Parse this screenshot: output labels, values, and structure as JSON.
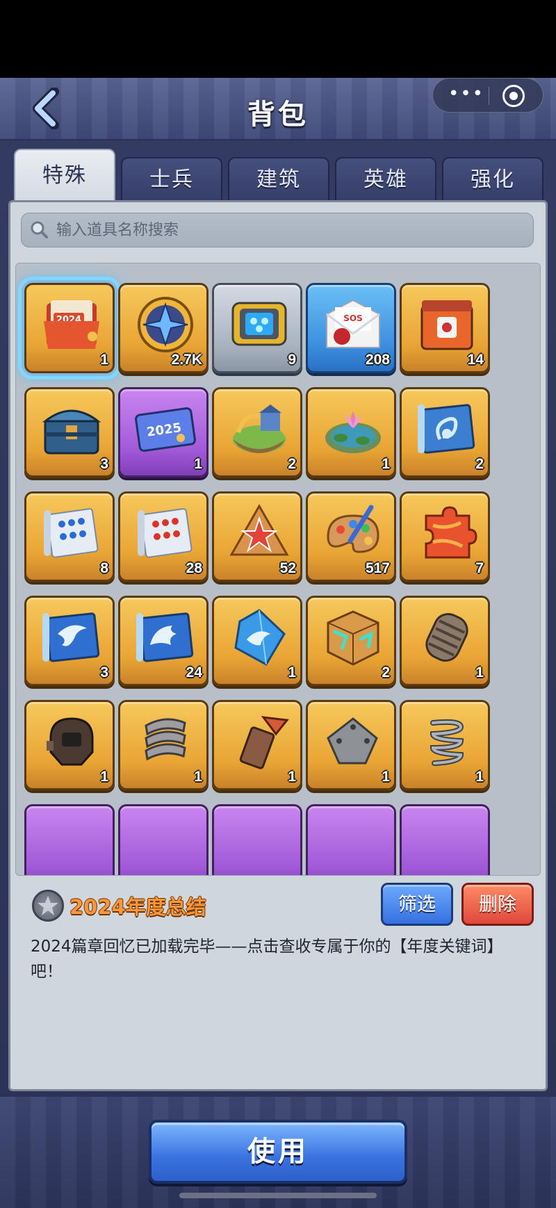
{
  "header": {
    "title": "背包",
    "more_glyph": "•••"
  },
  "tabs": [
    {
      "label": "特殊",
      "active": true
    },
    {
      "label": "士兵",
      "active": false
    },
    {
      "label": "建筑",
      "active": false
    },
    {
      "label": "英雄",
      "active": false
    },
    {
      "label": "强化",
      "active": false
    }
  ],
  "search": {
    "placeholder": "输入道具名称搜索"
  },
  "items": [
    {
      "icon": "folder-2024-icon",
      "count": "1",
      "frame": "gold",
      "selected": true
    },
    {
      "icon": "blue-star-medal-icon",
      "count": "2.7K",
      "frame": "gold"
    },
    {
      "icon": "blue-chip-device-icon",
      "count": "9",
      "frame": "grey"
    },
    {
      "icon": "sos-letter-icon",
      "count": "208",
      "frame": "blue"
    },
    {
      "icon": "orange-crate-icon",
      "count": "14",
      "frame": "gold"
    },
    {
      "icon": "blue-chest-icon",
      "count": "3",
      "frame": "gold"
    },
    {
      "icon": "card-2025-icon",
      "count": "1",
      "frame": "purple"
    },
    {
      "icon": "island-building-icon",
      "count": "2",
      "frame": "gold"
    },
    {
      "icon": "lotus-pond-icon",
      "count": "1",
      "frame": "gold"
    },
    {
      "icon": "scorpion-scroll-icon",
      "count": "2",
      "frame": "gold"
    },
    {
      "icon": "blue-dots-scroll-icon",
      "count": "8",
      "frame": "gold"
    },
    {
      "icon": "red-dots-scroll-icon",
      "count": "28",
      "frame": "gold"
    },
    {
      "icon": "star-cookie-icon",
      "count": "52",
      "frame": "gold"
    },
    {
      "icon": "paint-palette-icon",
      "count": "517",
      "frame": "gold"
    },
    {
      "icon": "puzzle-piece-icon",
      "count": "7",
      "frame": "gold"
    },
    {
      "icon": "eagle-scroll-icon",
      "count": "3",
      "frame": "gold"
    },
    {
      "icon": "shark-scroll-icon",
      "count": "24",
      "frame": "gold"
    },
    {
      "icon": "eagle-crystal-icon",
      "count": "1",
      "frame": "gold"
    },
    {
      "icon": "cube-icon",
      "count": "2",
      "frame": "gold"
    },
    {
      "icon": "coil-part-icon",
      "count": "1",
      "frame": "gold"
    },
    {
      "icon": "helmet-part-icon",
      "count": "1",
      "frame": "gold"
    },
    {
      "icon": "armor-plates-icon",
      "count": "1",
      "frame": "gold"
    },
    {
      "icon": "funnel-part-icon",
      "count": "1",
      "frame": "gold"
    },
    {
      "icon": "metal-plate-icon",
      "count": "1",
      "frame": "gold"
    },
    {
      "icon": "spring-icon",
      "count": "1",
      "frame": "gold"
    }
  ],
  "partial_row_frames": [
    "purple",
    "purple",
    "purple",
    "purple",
    "purple"
  ],
  "selected_item": {
    "name": "2024年度总结",
    "description": "2024篇章回忆已加载完毕——点击查收专属于你的【年度关键词】吧！"
  },
  "buttons": {
    "filter": "筛选",
    "delete": "删除",
    "use": "使用"
  },
  "colors": {
    "gold_frame": "#e9a534",
    "purple_frame": "#a25ad8",
    "blue_frame": "#3b8fde",
    "grey_frame": "#a9b3c0",
    "item_name": "#ff9638",
    "filter_button": "#3670e0",
    "delete_button": "#e0483a",
    "use_button": "#3a72e0"
  }
}
